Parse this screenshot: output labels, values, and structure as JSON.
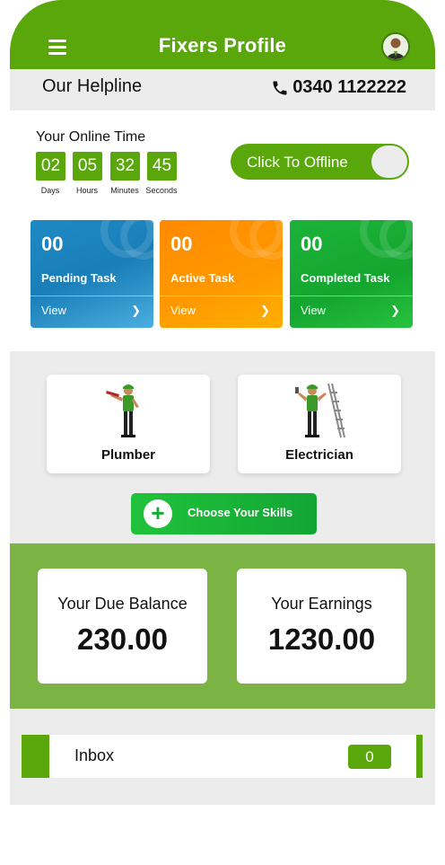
{
  "header": {
    "title": "Fixers Profile",
    "menu_icon": "hamburger-menu-icon",
    "avatar_icon": "user-avatar-icon"
  },
  "helpline": {
    "label": "Our Helpline",
    "number": "0340 1122222",
    "icon": "phone-icon"
  },
  "online_time": {
    "label": "Your Online Time",
    "units": [
      {
        "value": "02",
        "label": "Days"
      },
      {
        "value": "05",
        "label": "Hours"
      },
      {
        "value": "32",
        "label": "Minutes"
      },
      {
        "value": "45",
        "label": "Seconds"
      }
    ],
    "toggle_label": "Click To Offline"
  },
  "tasks": [
    {
      "count": "00",
      "name": "Pending Task",
      "action": "View",
      "color": "#1d8ac4"
    },
    {
      "count": "00",
      "name": "Active Task",
      "action": "View",
      "color": "#ff8a00"
    },
    {
      "count": "00",
      "name": "Completed Task",
      "action": "View",
      "color": "#1cb33a"
    }
  ],
  "skills": [
    {
      "name": "Plumber",
      "icon": "plumber-worker-icon"
    },
    {
      "name": "Electrician",
      "icon": "electrician-worker-icon"
    }
  ],
  "choose_skills": {
    "label": "Choose Your Skills",
    "icon": "plus-icon"
  },
  "balance": {
    "due_label": "Your Due Balance",
    "due_value": "230.00",
    "earnings_label": "Your Earnings",
    "earnings_value": "1230.00"
  },
  "inbox": {
    "label": "Inbox",
    "count": "0"
  },
  "colors": {
    "primary": "#5aa70c",
    "balance_bg": "#7bb344",
    "panel_bg": "#ececec"
  }
}
